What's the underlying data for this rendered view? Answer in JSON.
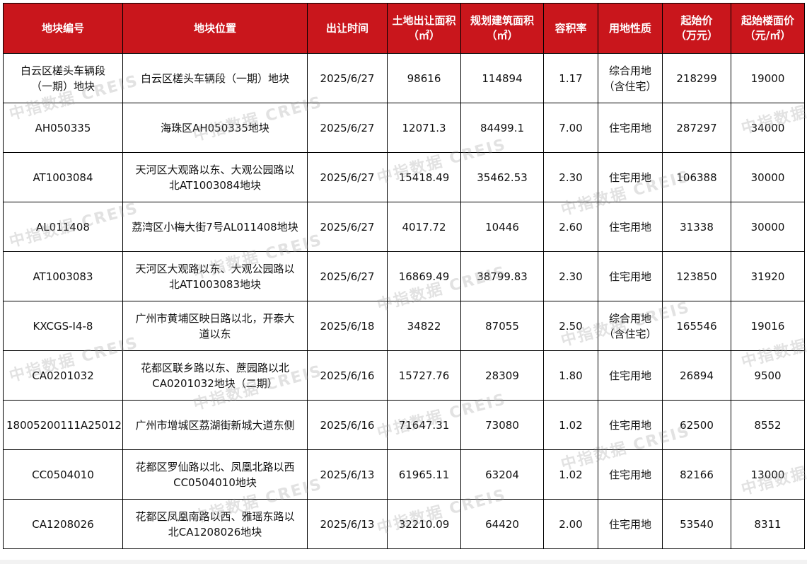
{
  "header": {
    "id": "地块编号",
    "location": "地块位置",
    "date": "出让时间",
    "land_area": "土地出让面积\n（㎡）",
    "build_area": "规划建筑面积\n（㎡）",
    "far": "容积率",
    "usage": "用地性质",
    "start_price": "起始价\n（万元）",
    "floor_price": "起始楼面价\n（元/㎡）"
  },
  "rows": [
    {
      "id": "白云区槎头车辆段\n（一期）地块",
      "location": "白云区槎头车辆段（一期）地块",
      "date": "2025/6/27",
      "land_area": "98616",
      "build_area": "114894",
      "far": "1.17",
      "usage": "综合用地\n（含住宅）",
      "start_price": "218299",
      "floor_price": "19000"
    },
    {
      "id": "AH050335",
      "location": "海珠区AH050335地块",
      "date": "2025/6/27",
      "land_area": "12071.3",
      "build_area": "84499.1",
      "far": "7.00",
      "usage": "住宅用地",
      "start_price": "287297",
      "floor_price": "34000"
    },
    {
      "id": "AT1003084",
      "location": "天河区大观路以东、大观公园路以\n北AT1003084地块",
      "date": "2025/6/27",
      "land_area": "15418.49",
      "build_area": "35462.53",
      "far": "2.30",
      "usage": "住宅用地",
      "start_price": "106388",
      "floor_price": "30000"
    },
    {
      "id": "AL011408",
      "location": "荔湾区小梅大街7号AL011408地块",
      "date": "2025/6/27",
      "land_area": "4017.72",
      "build_area": "10446",
      "far": "2.60",
      "usage": "住宅用地",
      "start_price": "31338",
      "floor_price": "30000"
    },
    {
      "id": "AT1003083",
      "location": "天河区大观路以东、大观公园路以\n北AT1003083地块",
      "date": "2025/6/27",
      "land_area": "16869.49",
      "build_area": "38799.83",
      "far": "2.30",
      "usage": "住宅用地",
      "start_price": "123850",
      "floor_price": "31920"
    },
    {
      "id": "KXCGS-I4-8",
      "location": "广州市黄埔区映日路以北，开泰大\n道以东",
      "date": "2025/6/18",
      "land_area": "34822",
      "build_area": "87055",
      "far": "2.50",
      "usage": "综合用地\n（含住宅）",
      "start_price": "165546",
      "floor_price": "19016"
    },
    {
      "id": "CA0201032",
      "location": "花都区联乡路以东、蔗园路以北\nCA0201032地块（二期）",
      "date": "2025/6/16",
      "land_area": "15727.76",
      "build_area": "28309",
      "far": "1.80",
      "usage": "住宅用地",
      "start_price": "26894",
      "floor_price": "9500"
    },
    {
      "id": "18005200111A25012",
      "location": "广州市增城区荔湖街新城大道东侧",
      "date": "2025/6/16",
      "land_area": "71647.31",
      "build_area": "73080",
      "far": "1.02",
      "usage": "住宅用地",
      "start_price": "62500",
      "floor_price": "8552"
    },
    {
      "id": "CC0504010",
      "location": "花都区罗仙路以北、凤凰北路以西\nCC0504010地块",
      "date": "2025/6/13",
      "land_area": "61965.11",
      "build_area": "63204",
      "far": "1.02",
      "usage": "住宅用地",
      "start_price": "82166",
      "floor_price": "13000"
    },
    {
      "id": "CA1208026",
      "location": "花都区凤凰南路以西、雅瑶东路以\n北CA1208026地块",
      "date": "2025/6/13",
      "land_area": "32210.09",
      "build_area": "64420",
      "far": "2.00",
      "usage": "住宅用地",
      "start_price": "53540",
      "floor_price": "8311"
    }
  ],
  "watermark": "中指数据 CREIS",
  "colors": {
    "header_bg": "#c9161c",
    "header_text": "#ffffff",
    "border": "#000000"
  }
}
